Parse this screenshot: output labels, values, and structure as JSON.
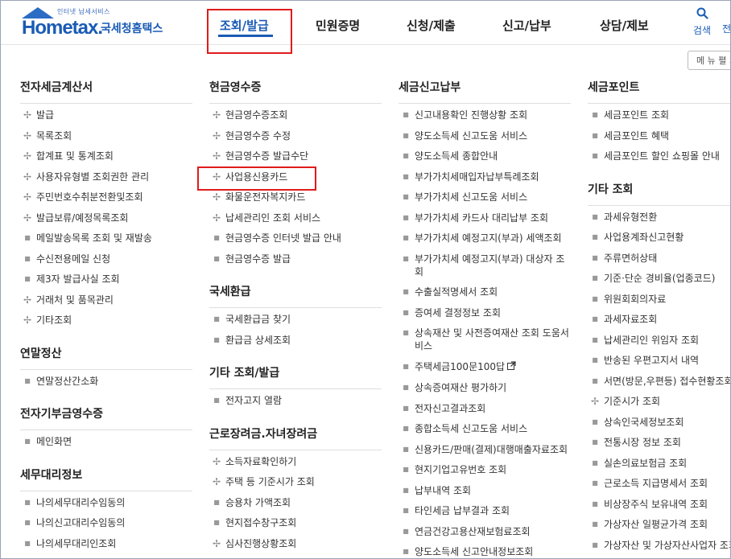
{
  "header": {
    "logo_tag": "인터넷 납세서비스",
    "logo_brand": "Hometax.",
    "logo_brand_ko": "국세청홈택스",
    "nav": [
      "조회/발급",
      "민원증명",
      "신청/제출",
      "신고/납부",
      "상담/제보"
    ],
    "search_icon": "search-icon",
    "search_label": "검색",
    "more_label": "전",
    "menu_button_label": "메 뉴 펼 쳐"
  },
  "columns": [
    {
      "sections": [
        {
          "title": "전자세금계산서",
          "items": [
            {
              "text": "발급",
              "marker": "plus"
            },
            {
              "text": "목록조회",
              "marker": "plus"
            },
            {
              "text": "합계표 및 통계조회",
              "marker": "plus"
            },
            {
              "text": "사용자유형별 조회권한 관리",
              "marker": "plus"
            },
            {
              "text": "주민번호수취분전환및조회",
              "marker": "plus"
            },
            {
              "text": "발급보류/예정목록조회",
              "marker": "plus"
            },
            {
              "text": "메일발송목록 조회 및 재발송",
              "marker": "dot"
            },
            {
              "text": "수신전용메일 신청",
              "marker": "dot"
            },
            {
              "text": "제3자 발급사실 조회",
              "marker": "dot"
            },
            {
              "text": "거래처 및 품목관리",
              "marker": "plus"
            },
            {
              "text": "기타조회",
              "marker": "plus"
            }
          ]
        },
        {
          "title": "연말정산",
          "items": [
            {
              "text": "연말정산간소화",
              "marker": "dot"
            }
          ]
        },
        {
          "title": "전자기부금영수증",
          "items": [
            {
              "text": "메인화면",
              "marker": "dot"
            }
          ]
        },
        {
          "title": "세무대리정보",
          "items": [
            {
              "text": "나의세무대리수임동의",
              "marker": "dot"
            },
            {
              "text": "나의신고대리수임동의",
              "marker": "dot"
            },
            {
              "text": "나의세무대리인조회",
              "marker": "dot"
            }
          ]
        }
      ]
    },
    {
      "sections": [
        {
          "title": "현금영수증",
          "items": [
            {
              "text": "현금영수증조회",
              "marker": "plus"
            },
            {
              "text": "현금영수증 수정",
              "marker": "plus"
            },
            {
              "text": "현금영수증 발급수단",
              "marker": "plus"
            },
            {
              "text": "사업용신용카드",
              "marker": "plus"
            },
            {
              "text": "화물운전자복지카드",
              "marker": "plus"
            },
            {
              "text": "납세관리인 조회 서비스",
              "marker": "plus"
            },
            {
              "text": "현금영수증 인터넷 발급 안내",
              "marker": "dot"
            },
            {
              "text": "현금영수증 발급",
              "marker": "dot"
            }
          ]
        },
        {
          "title": "국세환급",
          "items": [
            {
              "text": "국세환급금 찾기",
              "marker": "dot"
            },
            {
              "text": "환급금 상세조회",
              "marker": "dot"
            }
          ]
        },
        {
          "title": "기타 조회/발급",
          "items": [
            {
              "text": "전자고지 열람",
              "marker": "dot"
            }
          ]
        },
        {
          "title": "근로장려금.자녀장려금",
          "items": [
            {
              "text": "소득자료확인하기",
              "marker": "plus"
            },
            {
              "text": "주택 등 기준시가 조회",
              "marker": "plus"
            },
            {
              "text": "승용차 가액조회",
              "marker": "dot"
            },
            {
              "text": "현지접수창구조회",
              "marker": "dot"
            },
            {
              "text": "심사진행상황조회",
              "marker": "plus"
            }
          ]
        }
      ]
    },
    {
      "sections": [
        {
          "title": "세금신고납부",
          "items": [
            {
              "text": "신고내용확인 진행상황 조회",
              "marker": "dot"
            },
            {
              "text": "양도소득세 신고도움 서비스",
              "marker": "dot"
            },
            {
              "text": "양도소득세 종합안내",
              "marker": "dot"
            },
            {
              "text": "부가가치세매입자납부특례조회",
              "marker": "dot"
            },
            {
              "text": "부가가치세 신고도움 서비스",
              "marker": "dot"
            },
            {
              "text": "부가가치세 카드사 대리납부 조회",
              "marker": "dot"
            },
            {
              "text": "부가가치세 예정고지(부과) 세액조회",
              "marker": "dot"
            },
            {
              "text": "부가가치세 예정고지(부과) 대상자 조회",
              "marker": "dot"
            },
            {
              "text": "수출실적명세서 조회",
              "marker": "dot"
            },
            {
              "text": "증여세 결정정보 조회",
              "marker": "dot"
            },
            {
              "text": "상속재산 및 사전증여재산 조회 도움서비스",
              "marker": "dot"
            },
            {
              "text": "주택세금100문100답",
              "marker": "dot",
              "ext": true
            },
            {
              "text": "상속증여재산 평가하기",
              "marker": "dot"
            },
            {
              "text": "전자신고결과조회",
              "marker": "dot"
            },
            {
              "text": "종합소득세 신고도움 서비스",
              "marker": "dot"
            },
            {
              "text": "신용카드/판매(결제)대행매출자료조회",
              "marker": "dot"
            },
            {
              "text": "현지기업고유번호 조회",
              "marker": "dot"
            },
            {
              "text": "납부내역 조회",
              "marker": "dot"
            },
            {
              "text": "타인세금 납부결과 조회",
              "marker": "dot"
            },
            {
              "text": "연금건강고용산재보험료조회",
              "marker": "dot"
            },
            {
              "text": "양도소득세 신고안내정보조회",
              "marker": "dot"
            }
          ]
        }
      ]
    },
    {
      "sections": [
        {
          "title": "세금포인트",
          "items": [
            {
              "text": "세금포인트 조회",
              "marker": "dot"
            },
            {
              "text": "세금포인트 혜택",
              "marker": "dot"
            },
            {
              "text": "세금포인트 할인 쇼핑몰 안내",
              "marker": "dot"
            }
          ]
        },
        {
          "title": "기타 조회",
          "items": [
            {
              "text": "과세유형전환",
              "marker": "dot"
            },
            {
              "text": "사업용계좌신고현황",
              "marker": "dot"
            },
            {
              "text": "주류면허상태",
              "marker": "dot"
            },
            {
              "text": "기준·단순 경비율(업종코드)",
              "marker": "dot"
            },
            {
              "text": "위원회회의자료",
              "marker": "dot"
            },
            {
              "text": "과세자료조회",
              "marker": "dot"
            },
            {
              "text": "납세관리인 위임자 조회",
              "marker": "dot"
            },
            {
              "text": "반송된 우편고지서 내역",
              "marker": "dot"
            },
            {
              "text": "서면(방문,우편등) 접수현황조회",
              "marker": "dot"
            },
            {
              "text": "기준시가 조회",
              "marker": "plus"
            },
            {
              "text": "상속인국세정보조회",
              "marker": "dot"
            },
            {
              "text": "전통시장 정보 조회",
              "marker": "dot"
            },
            {
              "text": "실손의료보험금 조회",
              "marker": "dot"
            },
            {
              "text": "근로소득 지급명세서 조회",
              "marker": "dot"
            },
            {
              "text": "비상장주식 보유내역 조회",
              "marker": "dot"
            },
            {
              "text": "가상자산 일평균가격 조회",
              "marker": "dot"
            },
            {
              "text": "가상자산 및 가상자산사업자 조회",
              "marker": "dot"
            }
          ]
        }
      ]
    }
  ]
}
